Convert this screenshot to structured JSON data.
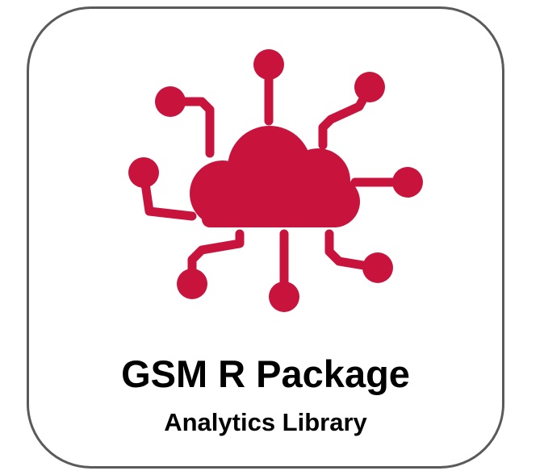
{
  "card": {
    "icon": "cloud-network-icon",
    "accent_color": "#c8143c",
    "border_color": "#5a5a5a",
    "title": "GSM R Package",
    "subtitle": "Analytics Library"
  }
}
